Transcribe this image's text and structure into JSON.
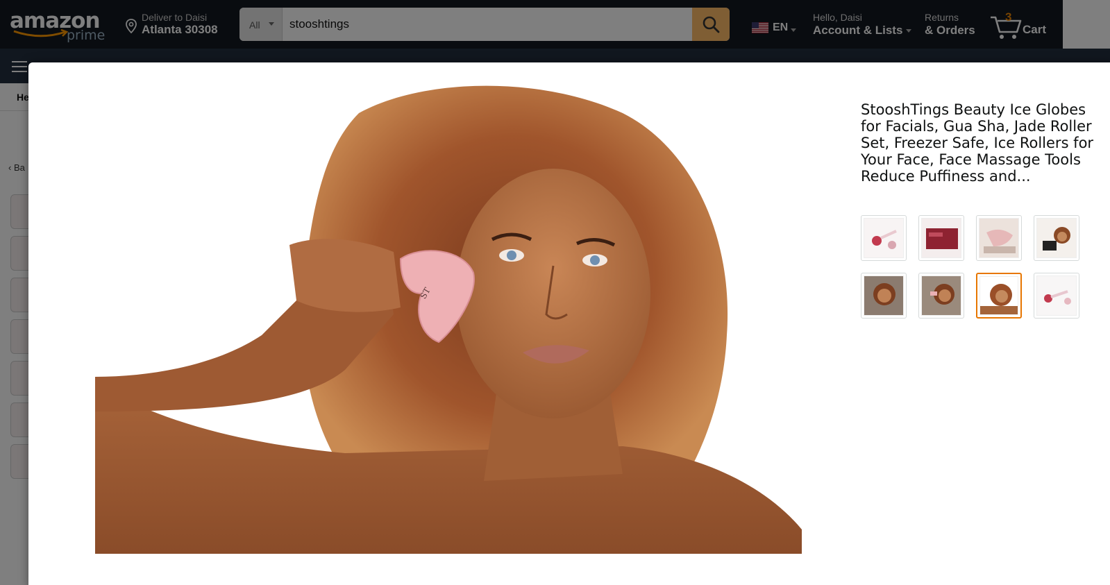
{
  "header": {
    "logo_text": "amazon",
    "logo_sub": "prime",
    "deliver_line1": "Deliver to Daisi",
    "deliver_line2": "Atlanta 30308",
    "search_category": "All",
    "search_query": "stooshtings",
    "lang_code": "EN",
    "account_line1": "Hello, Daisi",
    "account_line2": "Account & Lists",
    "returns_line1": "Returns",
    "returns_line2": "& Orders",
    "cart_count": "3",
    "cart_label": "Cart"
  },
  "background": {
    "subnav_fragment": "He",
    "back_fragment": "Ba"
  },
  "modal": {
    "product_title": "StooshTings Beauty Ice Globes for Facials, Gua Sha, Jade Roller Set, Freezer Safe, Ice Rollers for Your Face, Face Massage Tools Reduce Puffiness and...",
    "selected_thumbnail_index": 6,
    "thumbnails": [
      {
        "icon": "ice-globes-product-image"
      },
      {
        "icon": "packaging-product-image"
      },
      {
        "icon": "gua-sha-product-image"
      },
      {
        "icon": "model-with-box-image"
      },
      {
        "icon": "model-facial-image"
      },
      {
        "icon": "model-gua-sha-image"
      },
      {
        "icon": "model-portrait-image"
      },
      {
        "icon": "roller-product-image"
      }
    ]
  },
  "colors": {
    "header_bg": "#131921",
    "nav_bg": "#232f3e",
    "search_button": "#febd69",
    "cart_count": "#f08804",
    "selected_border": "#e77600"
  }
}
